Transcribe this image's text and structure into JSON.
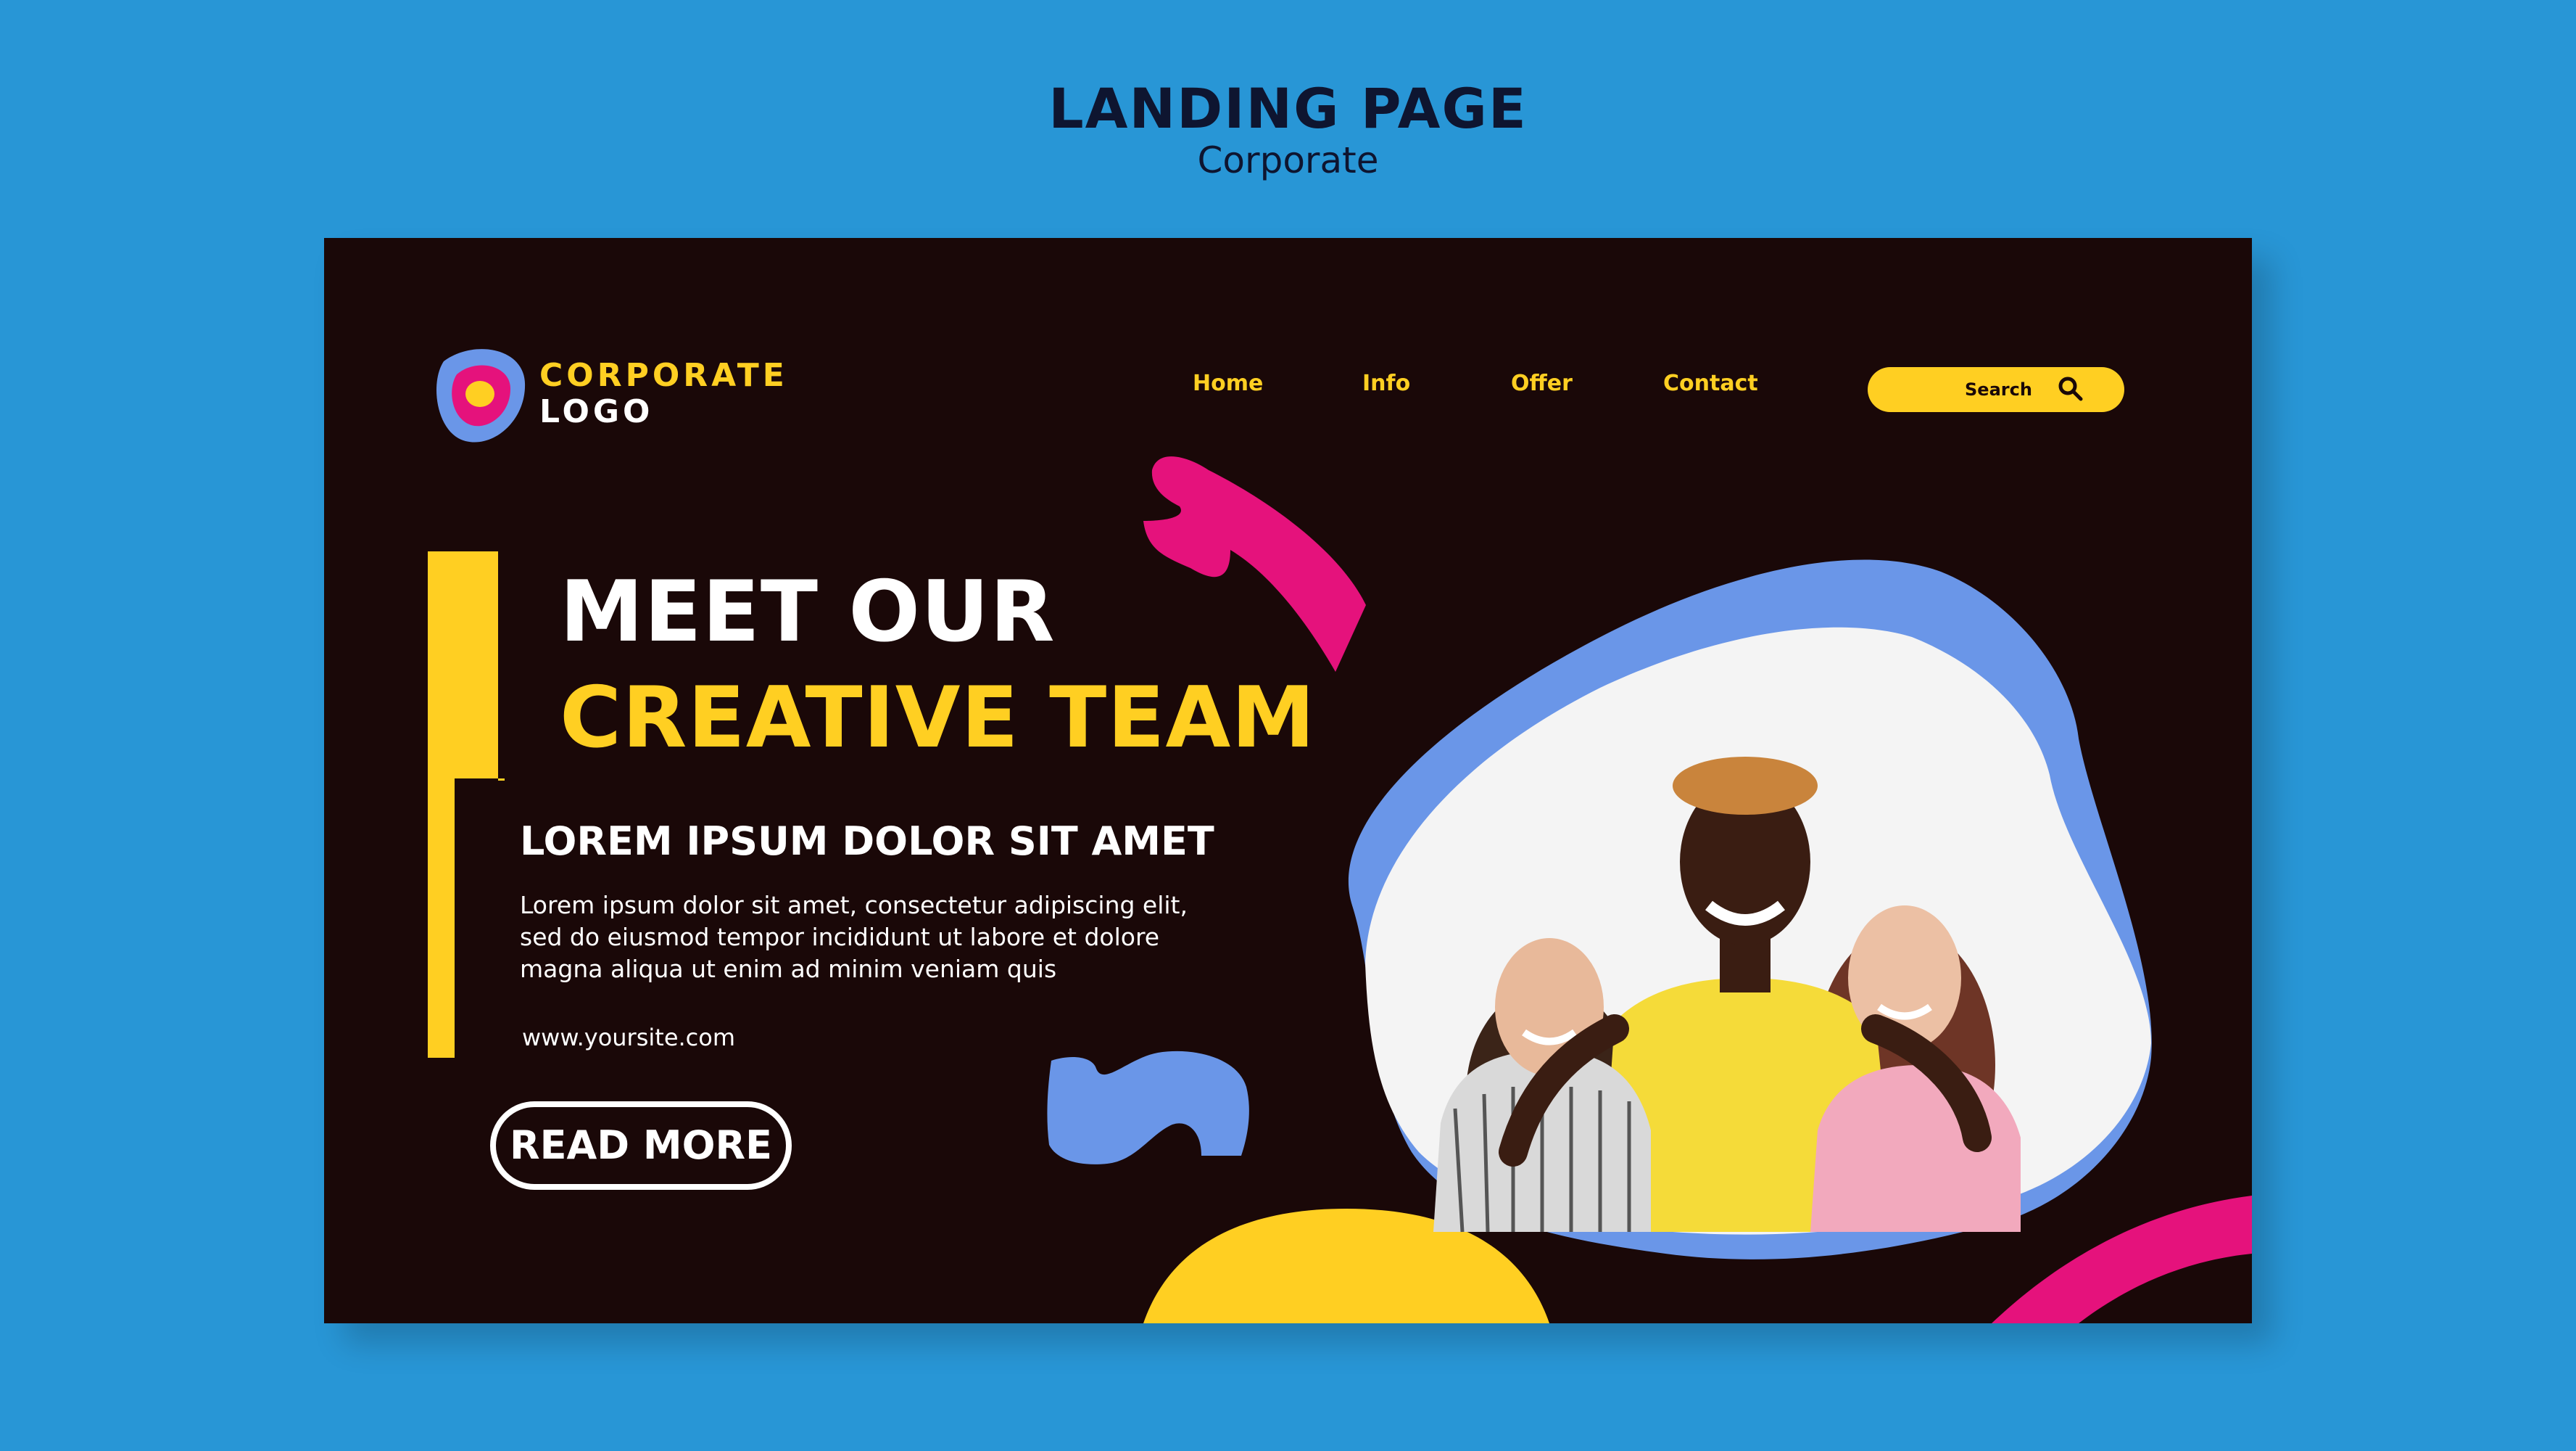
{
  "mockup": {
    "title": "LANDING PAGE",
    "subtitle": "Corporate"
  },
  "logo": {
    "line1": "CORPORATE",
    "line2": "LOGO"
  },
  "nav": {
    "items": [
      {
        "label": "Home"
      },
      {
        "label": "Info"
      },
      {
        "label": "Offer"
      },
      {
        "label": "Contact"
      }
    ]
  },
  "search": {
    "label": "Search",
    "icon": "search-icon"
  },
  "hero": {
    "headline_line1": "MEET OUR",
    "headline_line2": "CREATIVE TEAM",
    "subheading": "LOREM IPSUM DOLOR SIT AMET",
    "body": "Lorem ipsum dolor sit amet, consectetur adipiscing elit, sed do eiusmod tempor incididunt ut labore et dolore magna aliqua ut enim ad minim veniam quis",
    "website": "www.yoursite.com",
    "cta_label": "READ MORE"
  },
  "colors": {
    "background": "#2896d6",
    "page": "#1a0808",
    "yellow": "#ffcf22",
    "magenta": "#e5127c",
    "periwinkle": "#6a96e8",
    "white": "#ffffff"
  }
}
